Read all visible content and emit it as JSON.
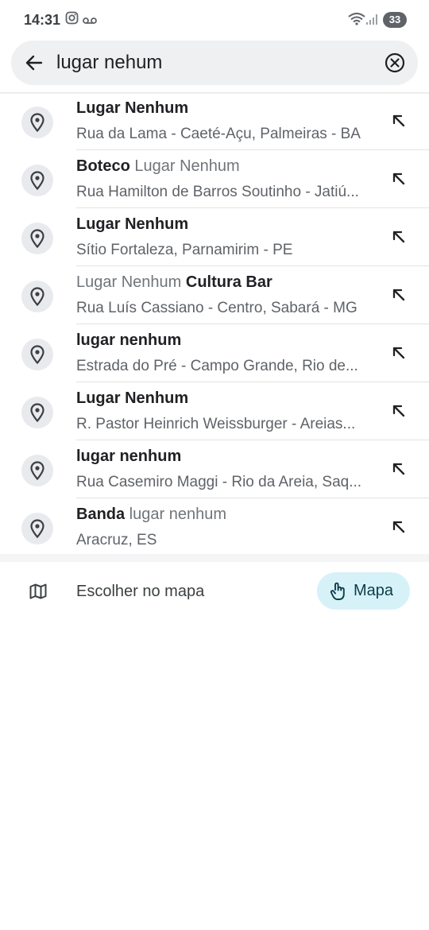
{
  "status_bar": {
    "time": "14:31",
    "battery": "33"
  },
  "search": {
    "query": "lugar nehum"
  },
  "results": [
    {
      "title_parts": [
        {
          "text": "Lugar Nenhum",
          "bold": true
        }
      ],
      "address": "Rua da Lama - Caeté-Açu, Palmeiras - BA"
    },
    {
      "title_parts": [
        {
          "text": "Boteco",
          "bold": true
        },
        {
          "text": " Lugar Nenhum",
          "bold": false
        }
      ],
      "address": "Rua Hamilton de Barros Soutinho - Jatiú..."
    },
    {
      "title_parts": [
        {
          "text": "Lugar Nenhum",
          "bold": true
        }
      ],
      "address": "Sítio Fortaleza, Parnamirim - PE"
    },
    {
      "title_parts": [
        {
          "text": "Lugar Nenhum",
          "bold": false
        },
        {
          "text": " Cultura Bar",
          "bold": true
        }
      ],
      "address": "Rua Luís Cassiano - Centro, Sabará - MG"
    },
    {
      "title_parts": [
        {
          "text": "lugar nenhum",
          "bold": true
        }
      ],
      "address": "Estrada do Pré - Campo Grande, Rio de..."
    },
    {
      "title_parts": [
        {
          "text": "Lugar Nenhum",
          "bold": true
        }
      ],
      "address": "R. Pastor Heinrich Weissburger - Areias..."
    },
    {
      "title_parts": [
        {
          "text": "lugar nenhum",
          "bold": true
        }
      ],
      "address": "Rua Casemiro Maggi - Rio da Areia, Saq..."
    },
    {
      "title_parts": [
        {
          "text": "Banda",
          "bold": true
        },
        {
          "text": " lugar nenhum",
          "bold": false
        }
      ],
      "address": "Aracruz, ES"
    }
  ],
  "choose_on_map": {
    "label": "Escolher no mapa",
    "button_label": "Mapa"
  },
  "colors": {
    "pin_background": "#e8eaed",
    "map_button_background": "#d6f2f8",
    "secondary_text": "#5f6368"
  },
  "icons": {
    "back": "arrow-left-icon",
    "clear": "clear-circle-icon",
    "pin": "location-pin-icon",
    "fill": "arrow-up-left-icon",
    "map": "folded-map-icon",
    "touch": "tap-hand-icon"
  }
}
